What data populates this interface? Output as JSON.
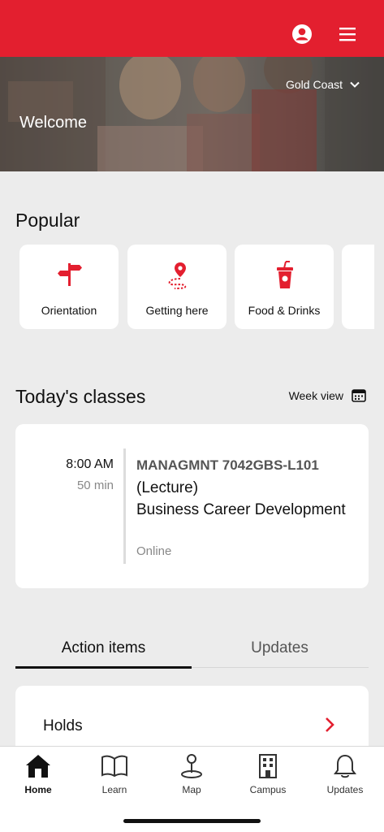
{
  "colors": {
    "brand_red": "#e31f2f",
    "background": "#ececec",
    "card": "#ffffff"
  },
  "header": {
    "user_icon": "user-circle-icon",
    "menu_icon": "hamburger-menu-icon"
  },
  "hero": {
    "welcome": "Welcome",
    "campus": "Gold Coast"
  },
  "popular": {
    "title": "Popular",
    "tiles": [
      {
        "label": "Orientation",
        "icon": "signpost-icon"
      },
      {
        "label": "Getting here",
        "icon": "route-pin-icon"
      },
      {
        "label": "Food & Drinks",
        "icon": "drink-cup-icon"
      },
      {
        "label": "",
        "icon": ""
      }
    ]
  },
  "classes": {
    "title": "Today's classes",
    "week_view": "Week view",
    "items": [
      {
        "time": "8:00 AM",
        "duration": "50 min",
        "code": "MANAGMNT 7042GBS-L101",
        "name": "(Lecture)\nBusiness Career Development",
        "mode": "Online"
      }
    ]
  },
  "tabs": {
    "items": [
      "Action items",
      "Updates"
    ],
    "active": "Action items"
  },
  "action_items": [
    {
      "label": "Holds"
    }
  ],
  "bottom_nav": [
    {
      "label": "Home",
      "icon": "home-icon",
      "active": true
    },
    {
      "label": "Learn",
      "icon": "book-icon"
    },
    {
      "label": "Map",
      "icon": "map-pin-icon"
    },
    {
      "label": "Campus",
      "icon": "building-icon"
    },
    {
      "label": "Updates",
      "icon": "bell-icon"
    }
  ]
}
